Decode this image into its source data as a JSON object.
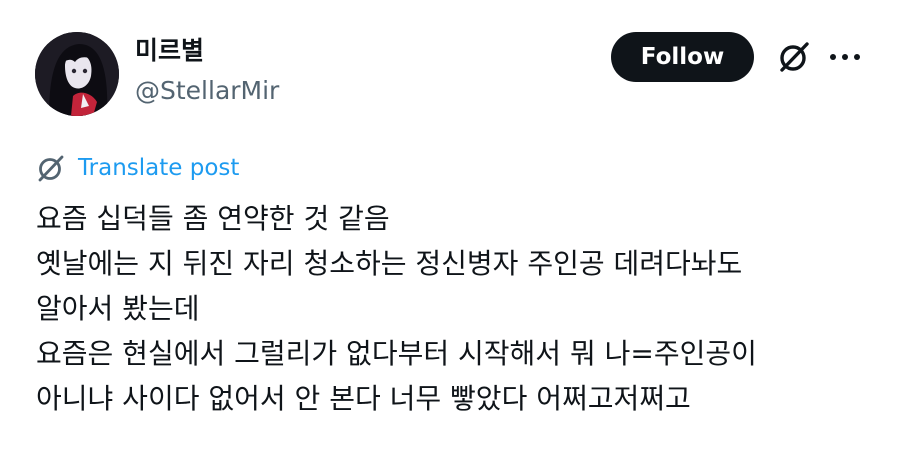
{
  "author": {
    "display_name": "미르별",
    "handle": "@StellarMir"
  },
  "actions": {
    "follow_label": "Follow"
  },
  "icons": {
    "grok": "grok-icon",
    "more": "more-icon",
    "translate": "translate-icon"
  },
  "translate": {
    "label": "Translate post"
  },
  "post": {
    "lines": [
      "요즘 십덕들 좀 연약한 것 같음",
      "옛날에는 지 뒤진 자리 청소하는 정신병자 주인공 데려다놔도",
      "알아서 봤는데",
      "요즘은 현실에서 그럴리가 없다부터 시작해서 뭐 나=주인공이",
      "아니냐 사이다 없어서 안 본다 너무 빻았다 어쩌고저쩌고"
    ]
  },
  "colors": {
    "text": "#0f1419",
    "secondary": "#536471",
    "link": "#1d9bf0",
    "button_bg": "#0f1419",
    "button_text": "#ffffff"
  }
}
